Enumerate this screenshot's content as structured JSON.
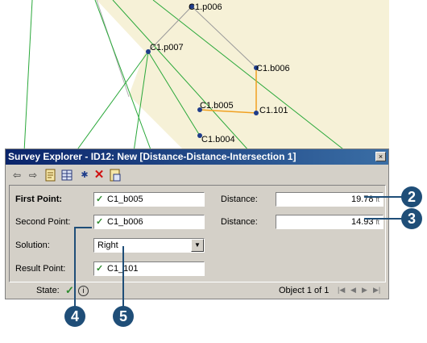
{
  "map": {
    "points": {
      "p006": "C1.p006",
      "p007": "C1.p007",
      "b006": "C1.b006",
      "b005": "C1.b005",
      "p101": "C1.101",
      "b004": "C1.b004"
    }
  },
  "dialog": {
    "title": "Survey Explorer - ID12: New [Distance-Distance-Intersection 1]",
    "close": "×",
    "fields": {
      "first_point_label": "First Point:",
      "first_point_value": "C1_b005",
      "second_point_label": "Second Point:",
      "second_point_value": "C1_b006",
      "solution_label": "Solution:",
      "solution_value": "Right",
      "result_point_label": "Result Point:",
      "result_point_value": "C1_101",
      "distance1_label": "Distance:",
      "distance1_value": "19.78",
      "distance1_unit": "ft",
      "distance2_label": "Distance:",
      "distance2_value": "14.93",
      "distance2_unit": "ft"
    },
    "status": {
      "state_label": "State:",
      "object_text": "Object 1 of 1"
    }
  },
  "callouts": [
    "2",
    "3",
    "4",
    "5"
  ],
  "colors": {
    "map_bg": "#f6f1d7",
    "line_green": "#2aa83a",
    "line_gray": "#9a9a9a",
    "line_orange": "#f0a020",
    "point": "#1f3d8a",
    "callout": "#1f4e78"
  }
}
